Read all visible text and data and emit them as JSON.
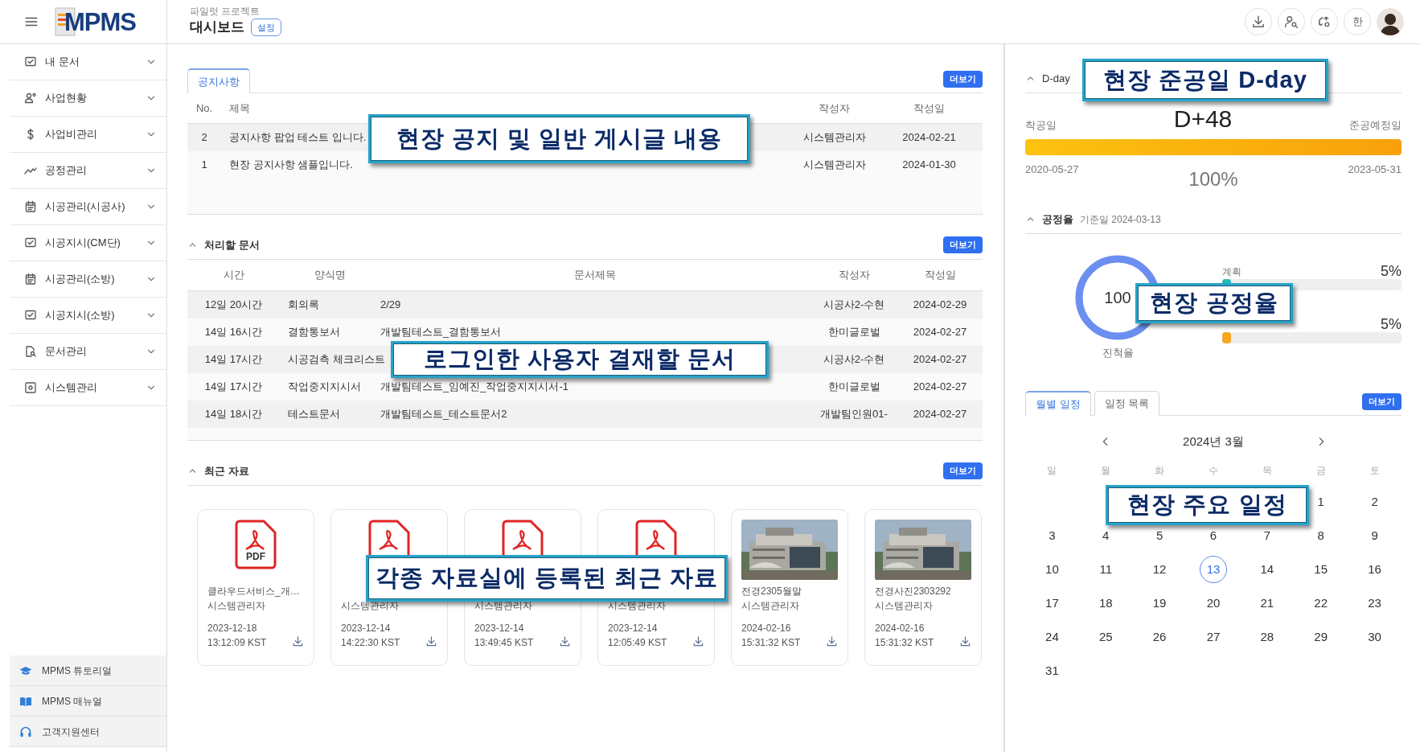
{
  "sidebar": {
    "logo": "MPMS",
    "items": [
      {
        "label": "내 문서",
        "expanded": false
      },
      {
        "label": "사업현황",
        "expanded": false
      },
      {
        "label": "사업비관리",
        "expanded": false
      },
      {
        "label": "공정관리",
        "expanded": false
      },
      {
        "label": "시공관리(시공사)",
        "expanded": false
      },
      {
        "label": "시공지시(CM단)",
        "expanded": false
      },
      {
        "label": "시공관리(소방)",
        "expanded": false
      },
      {
        "label": "시공지시(소방)",
        "expanded": false
      },
      {
        "label": "문서관리",
        "expanded": false
      },
      {
        "label": "시스템관리",
        "expanded": false
      }
    ],
    "footer_links": [
      "MPMS 튜토리얼",
      "MPMS 매뉴얼",
      "고객지원센터"
    ]
  },
  "header": {
    "project": "파일럿 프로젝트",
    "title": "대시보드",
    "settings_button": "설정",
    "language_button": "한"
  },
  "notices": {
    "tabs": [
      {
        "label": "공지사항",
        "selected": true
      }
    ],
    "more_button": "더보기",
    "columns": [
      "No.",
      "제목",
      "작성자",
      "작성일"
    ],
    "rows": [
      [
        "2",
        "공지사항 팝업 테스트 입니다.",
        "시스템관리자",
        "2024-02-21"
      ],
      [
        "1",
        "현장 공지사항 샘플입니다.",
        "시스템관리자",
        "2024-01-30"
      ]
    ]
  },
  "pending_docs": {
    "title": "처리할 문서",
    "expanded": true,
    "more_button": "더보기",
    "columns": [
      "시간",
      "양식명",
      "문서제목",
      "작성자",
      "작성일"
    ],
    "rows": [
      {
        "time": "12일 20시간",
        "form": "회의록",
        "title": "2/29",
        "author": "시공사2-수현",
        "date": "2024-02-29"
      },
      {
        "time": "14일 16시간",
        "form": "결함통보서",
        "title": "개발팀테스트_결함통보서",
        "author": "한미글로벌",
        "date": "2024-02-27"
      },
      {
        "time": "14일 17시간",
        "form": "시공검측 체크리스트",
        "author": "시공사2-수현",
        "date": "2024-02-27"
      },
      {
        "time": "14일 17시간",
        "form": "작업중지지시서",
        "title": "개발팀테스트_임예진_작업중지지시서-1",
        "author": "한미글로벌",
        "date": "2024-02-27"
      },
      {
        "time": "14일 18시간",
        "form": "테스트문서",
        "title": "개발팀테스트_테스트문서2",
        "author": "개발팀인원01-",
        "date": "2024-02-27"
      }
    ]
  },
  "recent_files": {
    "title": "최근 자료",
    "expanded": true,
    "more_button": "더보기",
    "items": [
      {
        "kind": "pdf",
        "type_label": "PDF",
        "name": "클라우드서비스_개…",
        "author": "시스템관리자",
        "date": "2023-12-18",
        "time": "13:12:09 KST"
      },
      {
        "kind": "pdf",
        "author": "시스템관리자",
        "date": "2023-12-14",
        "time": "14:22:30 KST"
      },
      {
        "kind": "pdf",
        "author": "시스템관리자",
        "date": "2023-12-14",
        "time": "13:49:45 KST"
      },
      {
        "kind": "pdf",
        "author": "시스템관리자",
        "date": "2023-12-14",
        "time": "12:05:49 KST"
      },
      {
        "kind": "picture",
        "name": "전경2305월말",
        "author": "시스템관리자",
        "date": "2024-02-16",
        "time": "15:31:32 KST"
      },
      {
        "kind": "picture",
        "name": "전경사진2303292",
        "author": "시스템관리자",
        "date": "2024-02-16",
        "time": "15:31:32 KST"
      }
    ]
  },
  "dday": {
    "title": "D-day",
    "expanded": true,
    "value": "D+48",
    "start_label": "착공일",
    "end_label": "준공예정일",
    "level": 1,
    "start_date": "2020-05-27",
    "end_date": "2023-05-31",
    "percent": "100%"
  },
  "progress": {
    "title": "공정율",
    "base_date": "기준일 2024-03-13",
    "expanded": true,
    "donut_value": "100",
    "donut_label": "진척율",
    "bars": [
      {
        "label": "계획",
        "reading": "5%",
        "level": 0.05,
        "color": "#1fbcb4"
      },
      {
        "reading": "5%",
        "level": 0.05,
        "color": "#f5a623"
      }
    ]
  },
  "schedule": {
    "tabs": [
      {
        "label": "월별 일정",
        "selected": true
      },
      {
        "label": "일정 목록",
        "selected": false
      }
    ],
    "more_button": "더보기",
    "month": "2024년 3월",
    "weekdays": [
      "일",
      "월",
      "화",
      "수",
      "목",
      "금",
      "토"
    ],
    "weeks": [
      [
        {
          "label": "1",
          "selected": false
        },
        {
          "label": "2",
          "selected": false
        }
      ],
      [
        {
          "label": "3",
          "selected": false
        },
        {
          "label": "4",
          "selected": false
        },
        {
          "label": "5",
          "selected": false
        },
        {
          "label": "6",
          "selected": false
        },
        {
          "label": "7",
          "selected": false
        },
        {
          "label": "8",
          "selected": false
        },
        {
          "label": "9",
          "selected": false
        }
      ],
      [
        {
          "label": "10",
          "selected": false
        },
        {
          "label": "11",
          "selected": false
        },
        {
          "label": "12",
          "selected": false
        },
        {
          "label": "13",
          "selected": true
        },
        {
          "label": "14",
          "selected": false
        },
        {
          "label": "15",
          "selected": false
        },
        {
          "label": "16",
          "selected": false
        }
      ],
      [
        {
          "label": "17",
          "selected": false
        },
        {
          "label": "18",
          "selected": false
        },
        {
          "label": "19",
          "selected": false
        },
        {
          "label": "20",
          "selected": false
        },
        {
          "label": "21",
          "selected": false
        },
        {
          "label": "22",
          "selected": false
        },
        {
          "label": "23",
          "selected": false
        }
      ],
      [
        {
          "label": "24",
          "selected": false
        },
        {
          "label": "25",
          "selected": false
        },
        {
          "label": "26",
          "selected": false
        },
        {
          "label": "27",
          "selected": false
        },
        {
          "label": "28",
          "selected": false
        },
        {
          "label": "29",
          "selected": false
        },
        {
          "label": "30",
          "selected": false
        }
      ],
      [
        {
          "label": "31",
          "selected": false
        }
      ]
    ]
  },
  "annotations": [
    "현장 공지 및 일반 게시글 내용",
    "로그인한 사용자 결재할 문서",
    "각종 자료실에 등록된 최근 자료",
    "현장 준공일 D-day",
    "현장 공정율",
    "현장 주요 일정"
  ]
}
